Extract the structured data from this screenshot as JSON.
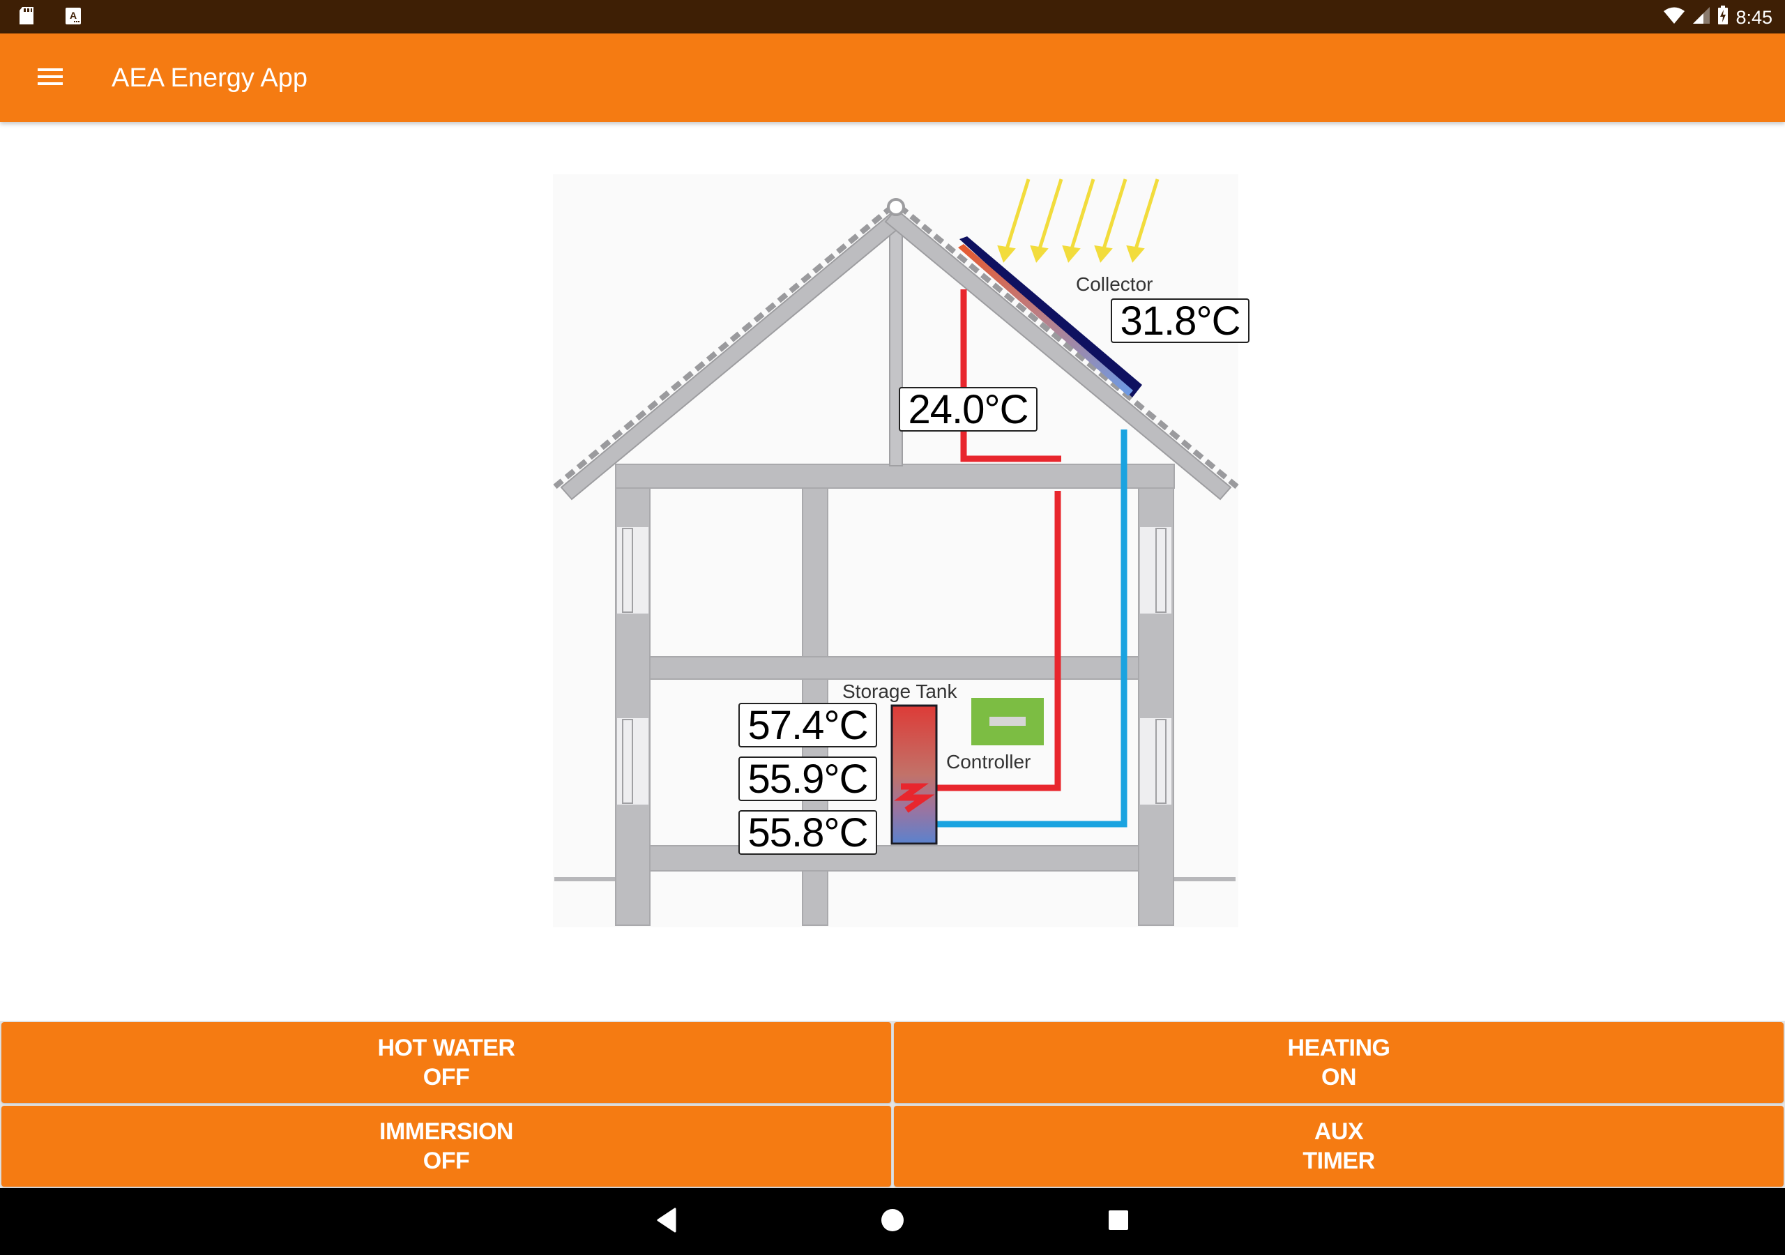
{
  "status_bar": {
    "left_icons": [
      "sd-card-icon",
      "text-a-icon"
    ],
    "right_icons": [
      "wifi-icon",
      "cell-signal-icon",
      "battery-charging-icon"
    ],
    "time": "8:45"
  },
  "app_bar": {
    "menu_icon": "hamburger-menu-icon",
    "title": "AEA Energy App",
    "background_color": "#f57b12"
  },
  "diagram": {
    "collector": {
      "label": "Collector",
      "temperature": "31.8°C"
    },
    "return_pipe_temperature": "24.0°C",
    "storage_tank": {
      "label": "Storage Tank",
      "temperatures": {
        "top": "57.4°C",
        "middle": "55.9°C",
        "bottom": "55.8°C"
      }
    },
    "controller": {
      "label": "Controller"
    },
    "colors": {
      "hot_pipe": "#e8262d",
      "cold_pipe": "#1aa3e0",
      "structure": "#bdbdc0",
      "sun_rays": "#f2dc3c",
      "collector_frame": "#0f1160",
      "controller_box": "#7cbd43"
    }
  },
  "controls": [
    {
      "name": "hot-water",
      "label": "HOT WATER",
      "state": "OFF"
    },
    {
      "name": "heating",
      "label": "HEATING",
      "state": "ON"
    },
    {
      "name": "immersion",
      "label": "IMMERSION",
      "state": "OFF"
    },
    {
      "name": "aux",
      "label": "AUX",
      "state": "TIMER"
    }
  ],
  "nav_bar": {
    "buttons": [
      "back-icon",
      "home-icon",
      "recents-icon"
    ]
  }
}
